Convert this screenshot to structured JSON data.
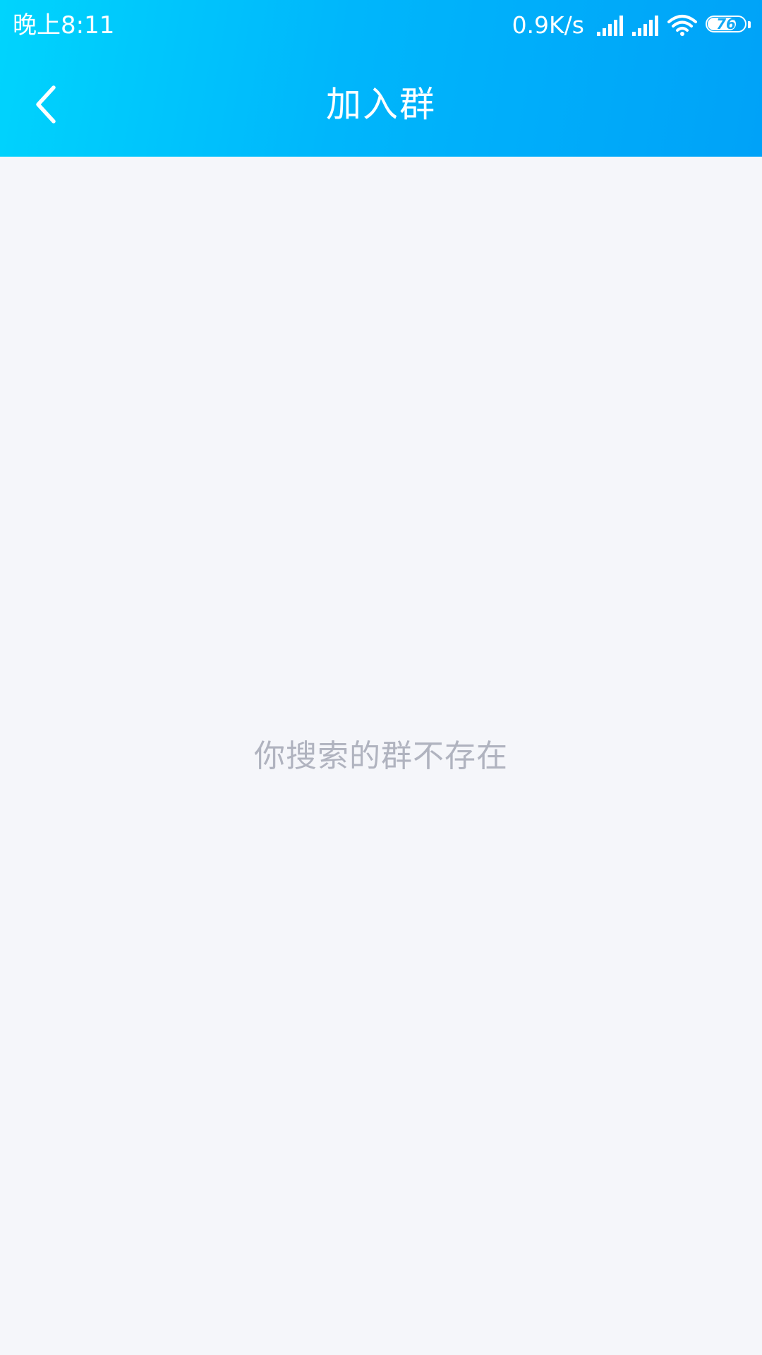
{
  "status_bar": {
    "time": "晚上8:11",
    "network_speed": "0.9K/s",
    "battery_level": "76",
    "battery_percent": 76,
    "icons": [
      "signal-icon",
      "signal-icon",
      "wifi-icon",
      "battery-icon"
    ]
  },
  "nav": {
    "title": "加入群",
    "back_icon": "chevron-left-icon"
  },
  "content": {
    "empty_message": "你搜索的群不存在"
  },
  "colors": {
    "header_start": "#00d4fd",
    "header_end": "#00a2f8",
    "background": "#f5f6fa",
    "empty_text": "#b0b3bf"
  }
}
